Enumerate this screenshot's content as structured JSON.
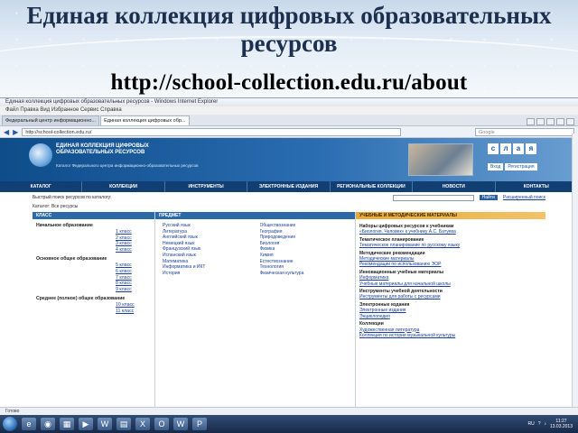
{
  "slide": {
    "title": "Единая коллекция цифровых образовательных ресурсов",
    "url": "http://school-collection.edu.ru/about"
  },
  "browser": {
    "window_title": "Единая коллекция цифровых образовательных ресурсов - Windows Internet Explorer",
    "menu": "Файл   Правка   Вид   Избранное   Сервис   Справка",
    "tabs": [
      "Федеральный центр информационно...",
      "Единая коллекция цифровых обр..."
    ],
    "address": "http://school-collection.edu.ru/",
    "search_placeholder": "Google"
  },
  "site": {
    "name": "ЕДИНАЯ КОЛЛЕКЦИЯ ЦИФРОВЫХ ОБРАЗОВАТЕЛЬНЫХ РЕСУРСОВ",
    "subtitle": "Каталог Федерального центра информационно-образовательных ресурсов",
    "tiles": [
      "с",
      "л",
      "а",
      "я"
    ],
    "register": [
      "Вход",
      "Регистрация"
    ],
    "nav": [
      "КАТАЛОГ",
      "КОЛЛЕКЦИИ",
      "ИНСТРУМЕНТЫ",
      "ЭЛЕКТРОННЫЕ ИЗДАНИЯ",
      "РЕГИОНАЛЬНЫЕ КОЛЛЕКЦИИ",
      "НОВОСТИ",
      "КОНТАКТЫ"
    ],
    "search_text": "Быстрый поиск ресурсов по каталогу:",
    "search_link": "Расширенный поиск",
    "search_button": "Найти",
    "crumb": "Каталог: Все ресурсы",
    "col_left_head": "КЛАСС",
    "col_mid_head": "ПРЕДМЕТ",
    "col_right_head": "УЧЕБНЫЕ И МЕТОДИЧЕСКИЕ МАТЕРИАЛЫ",
    "levels": [
      {
        "name": "Начальное образование",
        "grades": [
          "1 класс",
          "2 класс",
          "3 класс",
          "4 класс"
        ]
      },
      {
        "name": "Основное общее образование",
        "grades": [
          "5 класс",
          "6 класс",
          "7 класс",
          "8 класс",
          "9 класс"
        ]
      },
      {
        "name": "Среднее (полное) общее образование",
        "grades": [
          "10 класс",
          "11 класс"
        ]
      }
    ],
    "subjects_a": [
      "Русский язык",
      "Литература",
      "Английский язык",
      "Немецкий язык",
      "Французский язык",
      "Испанский язык",
      "Математика",
      "Информатика и ИКТ",
      "История"
    ],
    "subjects_b": [
      "Обществознание",
      "География",
      "Природоведение",
      "Биология",
      "Физика",
      "Химия",
      "Естествознание",
      "Технология",
      "Физическая культура"
    ],
    "right_items": [
      {
        "t": "Наборы цифровых ресурсов к учебникам",
        "k": "h"
      },
      {
        "t": "«Биология. Человек» к учебнику А.С. Батуева",
        "k": "l"
      },
      {
        "t": "Тематическое планирование",
        "k": "h"
      },
      {
        "t": "Тематическое планирование по русскому языку",
        "k": "l"
      },
      {
        "t": "Методические рекомендации",
        "k": "h"
      },
      {
        "t": "Методические материалы",
        "k": "l"
      },
      {
        "t": "Рекомендации по использованию ЭОР",
        "k": "l"
      },
      {
        "t": "Инновационные учебные материалы",
        "k": "h"
      },
      {
        "t": "Информатика",
        "k": "l"
      },
      {
        "t": "Учебные материалы для начальной школы",
        "k": "l"
      },
      {
        "t": "Инструменты учебной деятельности",
        "k": "h"
      },
      {
        "t": "Инструменты для работы с ресурсами",
        "k": "l"
      },
      {
        "t": "Электронные издания",
        "k": "h"
      },
      {
        "t": "Электронные издания",
        "k": "l"
      },
      {
        "t": "Энциклопедия",
        "k": "l"
      },
      {
        "t": "Коллекции",
        "k": "h"
      },
      {
        "t": "Художественная литература",
        "k": "l"
      },
      {
        "t": "Коллекция по истории музыкальной культуры",
        "k": "l"
      }
    ]
  },
  "status": "Готово",
  "taskbar": {
    "apps": [
      "ie",
      "firefox",
      "explorer",
      "media",
      "word",
      "folder",
      "excel",
      "outlook",
      "word2",
      "ppt"
    ],
    "lang": "RU",
    "time": "11:27",
    "date": "13.03.2013"
  }
}
